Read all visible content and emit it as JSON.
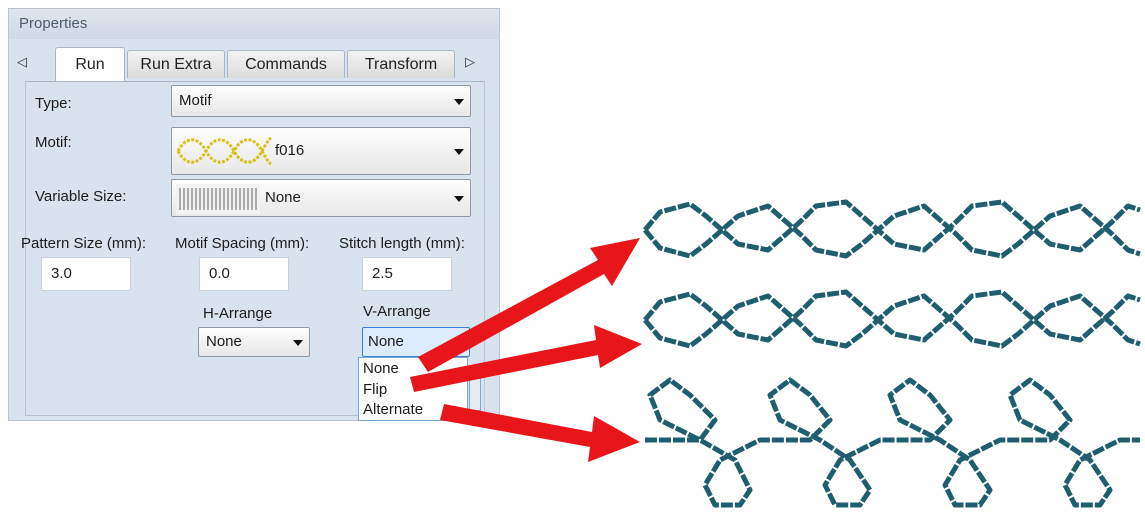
{
  "panel": {
    "title": "Properties",
    "tabs": [
      {
        "label": "Run",
        "active": true
      },
      {
        "label": "Run Extra",
        "active": false
      },
      {
        "label": "Commands",
        "active": false
      },
      {
        "label": "Transform",
        "active": false
      }
    ],
    "type": {
      "label": "Type:",
      "value": "Motif"
    },
    "motif": {
      "label": "Motif:",
      "value": "f016"
    },
    "variable_size": {
      "label": "Variable Size:",
      "value": "None"
    },
    "pattern_size": {
      "label": "Pattern Size (mm):",
      "value": "3.0"
    },
    "motif_spacing": {
      "label": "Motif Spacing (mm):",
      "value": "0.0"
    },
    "stitch_length": {
      "label": "Stitch length (mm):",
      "value": "2.5"
    },
    "h_arrange": {
      "label": "H-Arrange",
      "value": "None"
    },
    "v_arrange": {
      "label": "V-Arrange",
      "value": "None",
      "options": [
        "None",
        "Flip",
        "Alternate"
      ]
    }
  },
  "colors": {
    "panel_bg": "#d9e3ef",
    "motif_icon": "#d8c21a",
    "stitch": "#1e5e6e",
    "arrow": "#e8161b"
  }
}
